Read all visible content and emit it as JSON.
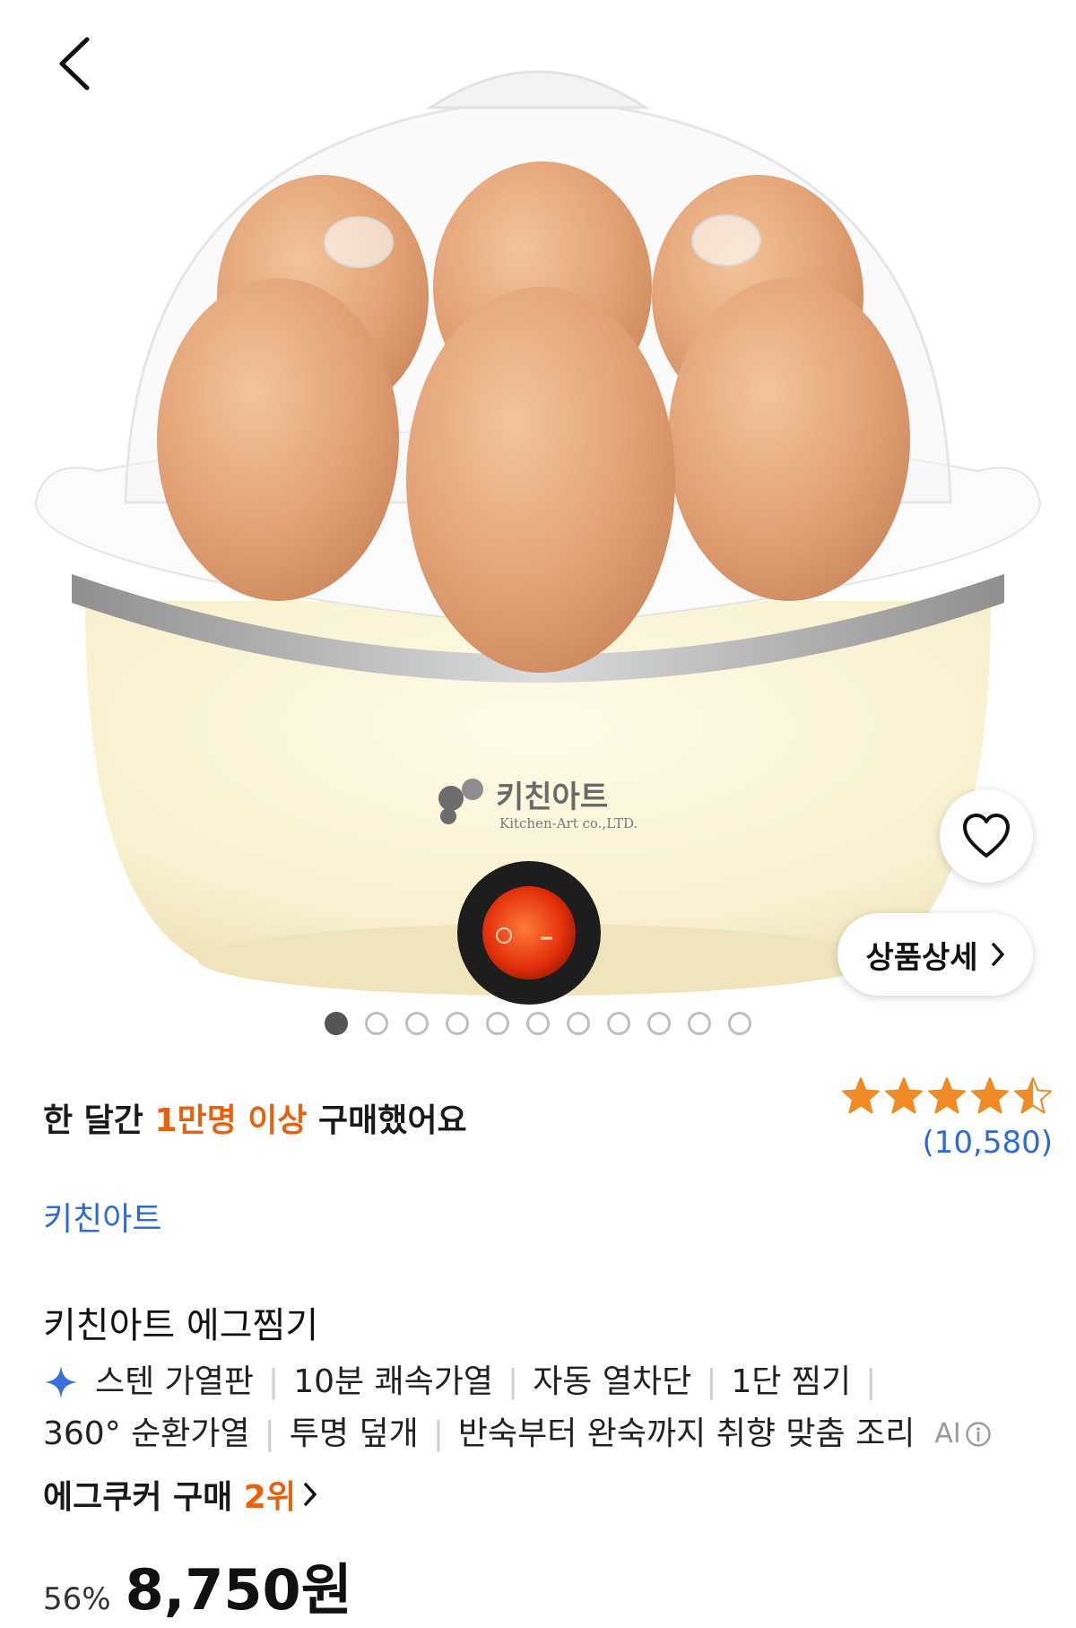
{
  "hero": {
    "brand_logo_text": "키친아트",
    "brand_logo_sub": "Kitchen-Art co.,LTD.",
    "detail_label": "상품상세",
    "carousel_count": 11,
    "carousel_active_index": 0
  },
  "purchase": {
    "prefix": "한 달간 ",
    "highlight": "1만명 이상",
    "suffix": " 구매했어요",
    "highlight_color": "#e8610f"
  },
  "rating": {
    "value": 4.5,
    "max": 5,
    "review_count": "(10,580)",
    "star_color": "#f08a24"
  },
  "brand": "키친아트",
  "product_title": "키친아트 에그찜기",
  "features_row1": [
    "스텐 가열판",
    "10분 쾌속가열",
    "자동 열차단",
    "1단 찜기"
  ],
  "features_row2": [
    "360° 순환가열",
    "투명 덮개",
    "반숙부터 완숙까지 취향 맞춤 조리"
  ],
  "ai_label": "AI",
  "rank": {
    "prefix": "에그쿠커 구매 ",
    "highlight": "2위"
  },
  "price": {
    "discount": "56%",
    "amount": "8,750원"
  },
  "colors": {
    "link_blue": "#2f6bd6",
    "accent_orange": "#e8610f"
  }
}
